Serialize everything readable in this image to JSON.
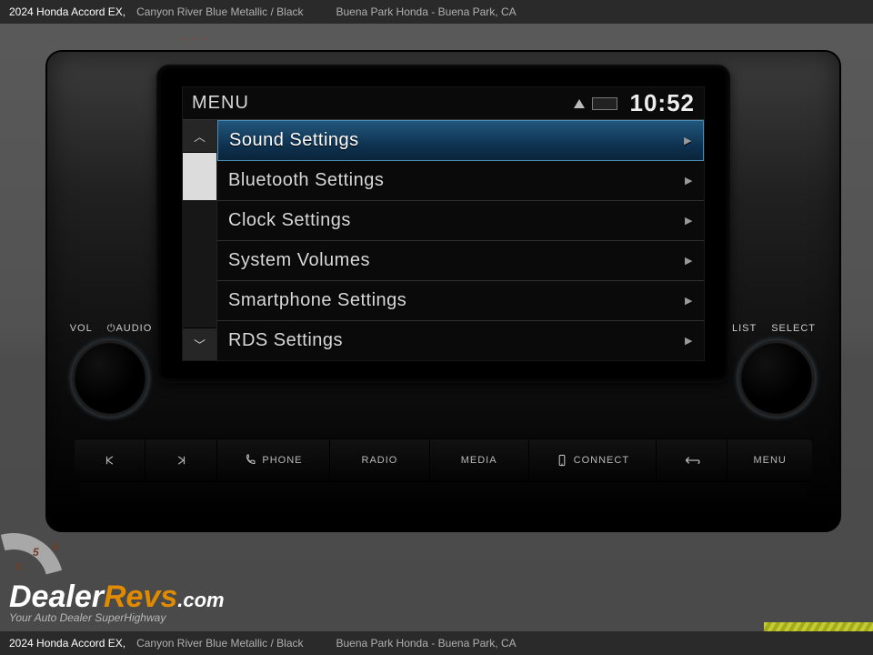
{
  "header": {
    "model": "2024 Honda Accord EX,",
    "color": "Canyon River Blue Metallic / Black",
    "dealer": "Buena Park Honda - Buena Park, CA"
  },
  "footer": {
    "model": "2024 Honda Accord EX,",
    "color": "Canyon River Blue Metallic / Black",
    "dealer": "Buena Park Honda - Buena Park, CA"
  },
  "screen": {
    "title": "MENU",
    "clock": "10:52",
    "items": [
      {
        "label": "Sound Settings",
        "selected": true
      },
      {
        "label": "Bluetooth Settings"
      },
      {
        "label": "Clock Settings"
      },
      {
        "label": "System Volumes"
      },
      {
        "label": "Smartphone Settings"
      },
      {
        "label": "RDS Settings"
      }
    ]
  },
  "knob_left": {
    "a": "VOL",
    "b": "AUDIO"
  },
  "knob_right": {
    "a": "LIST",
    "b": "SELECT"
  },
  "buttons": {
    "phone": "PHONE",
    "radio": "RADIO",
    "media": "MEDIA",
    "connect": "CONNECT",
    "menu": "MENU"
  },
  "watermark": {
    "brand_a": "Dealer",
    "brand_b": "Revs",
    "brand_c": ".com",
    "tagline": "Your Auto Dealer SuperHighway"
  },
  "gauge": {
    "n4": "4",
    "n5": "5",
    "n6": "6"
  }
}
